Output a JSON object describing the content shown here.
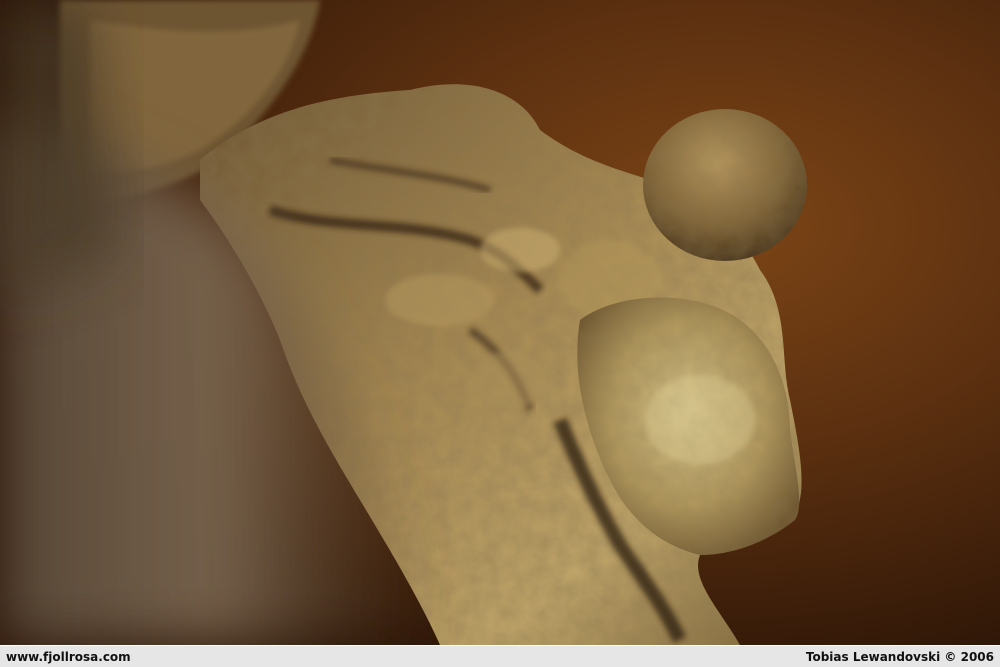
{
  "photo": {
    "subject": "cave-rock-formation",
    "palette": {
      "background": "#4a260c",
      "rock_light": "#c9a96a",
      "rock_mid": "#8a6a38",
      "rock_shadow": "#3c2a16",
      "blur_foreground": "#6e5c48"
    }
  },
  "caption": {
    "site": "www.fjollrosa.com",
    "credit": "Tobias Lewandovski © 2006"
  }
}
